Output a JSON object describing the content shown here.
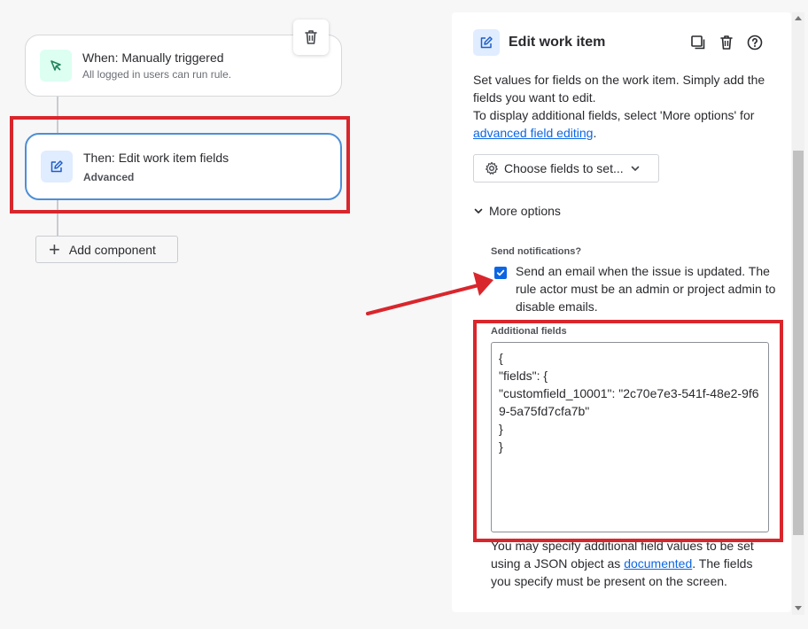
{
  "canvas": {
    "trigger_node": {
      "title": "When: Manually triggered",
      "subtitle": "All logged in users can run rule.",
      "icon": "cursor-click-icon"
    },
    "action_node": {
      "title": "Then: Edit work item fields",
      "subtitle": "Advanced",
      "icon": "edit-icon"
    },
    "delete_icon": "trash-icon",
    "add_component_label": "Add component"
  },
  "panel": {
    "title": "Edit work item",
    "header_icons": [
      "duplicate-icon",
      "trash-icon",
      "help-icon"
    ],
    "description_1": "Set values for fields on the work item. Simply add the fields you want to edit.",
    "description_2": "To display additional fields, select 'More options' for",
    "description_link": "advanced field editing",
    "description_end": ".",
    "choose_fields_label": "Choose fields to set...",
    "more_options_label": "More options",
    "send_notifications_label": "Send notifications?",
    "send_notifications_checked": true,
    "send_notifications_text": "Send an email when the issue is updated. The rule actor must be an admin or project admin to disable emails.",
    "additional_fields_label": "Additional fields",
    "additional_fields_value": "{\n\"fields\": {\n\"customfield_10001\": \"2c70e7e3-541f-48e2-9f69-5a75fd7cfa7b\"\n}\n}",
    "help_text_1": "You may specify additional field values to be set using a JSON object as",
    "help_link": "documented",
    "help_text_2": ". The fields you specify must be present on the screen."
  },
  "colors": {
    "highlight": "#d9262c",
    "accent": "#0c66e4",
    "trigger_icon_bg": "#dcfff1",
    "action_icon_bg": "#e0ecff"
  }
}
